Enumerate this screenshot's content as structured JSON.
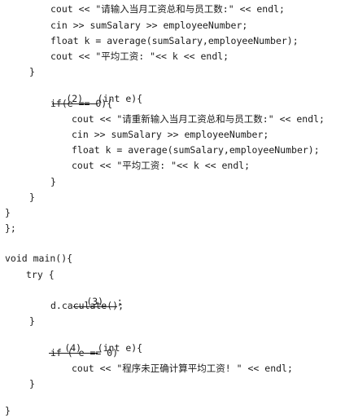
{
  "code": {
    "lines": [
      "cout << \"请输入当月工资总和与员工数:\" << endl;",
      "cin >> sumSalary >> employeeNumber;",
      "float k = average(sumSalary,employeeNumber);",
      "cout << \"平均工资: \"<< k << endl;",
      "}",
      "(int e){",
      "if(e == 0){",
      "cout << \"请重新输入当月工资总和与员工数:\" << endl;",
      "cin >> sumSalary >> employeeNumber;",
      "float k = average(sumSalary,employeeNumber);",
      "cout << \"平均工资: \"<< k << endl;",
      "}",
      "}",
      "}",
      "};",
      "void main(){",
      "try {",
      ";",
      "d.caculate();",
      "}",
      "(int e){",
      "if ( e == 0)",
      "cout << \"程序未正确计算平均工资! \" << endl;",
      "}",
      "}"
    ],
    "blanks": [
      "(2)",
      "(3)",
      "(4)"
    ]
  }
}
